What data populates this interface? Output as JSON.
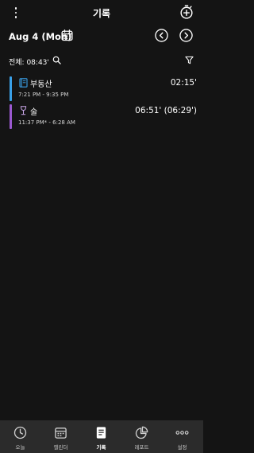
{
  "header": {
    "title": "기록"
  },
  "datebar": {
    "date": "Aug 4 (Mon)"
  },
  "summary": {
    "total": "전체: 08:43'"
  },
  "entries": [
    {
      "name": "부동산",
      "range": "7:21 PM - 9:35 PM",
      "duration": "02:15'",
      "color": "#3aa0e8",
      "icon": "book-icon"
    },
    {
      "name": "술",
      "range": "11:37 PM* - 6:28 AM",
      "duration": "06:51' (06:29')",
      "color": "#9b59d0",
      "icon": "wine-glass-icon"
    }
  ],
  "bottom_nav": {
    "items": [
      {
        "label": "오늘",
        "icon": "clock-icon",
        "active": false
      },
      {
        "label": "캘린더",
        "icon": "calendar-icon",
        "active": false
      },
      {
        "label": "기록",
        "icon": "document-icon",
        "active": true
      },
      {
        "label": "레포트",
        "icon": "pie-chart-icon",
        "active": false
      },
      {
        "label": "설정",
        "icon": "more-dots-icon",
        "active": false
      }
    ]
  },
  "colors": {
    "background": "#141414",
    "nav_background": "#2b2b2b",
    "accent_blue": "#3aa0e8",
    "accent_purple": "#9b59d0"
  }
}
